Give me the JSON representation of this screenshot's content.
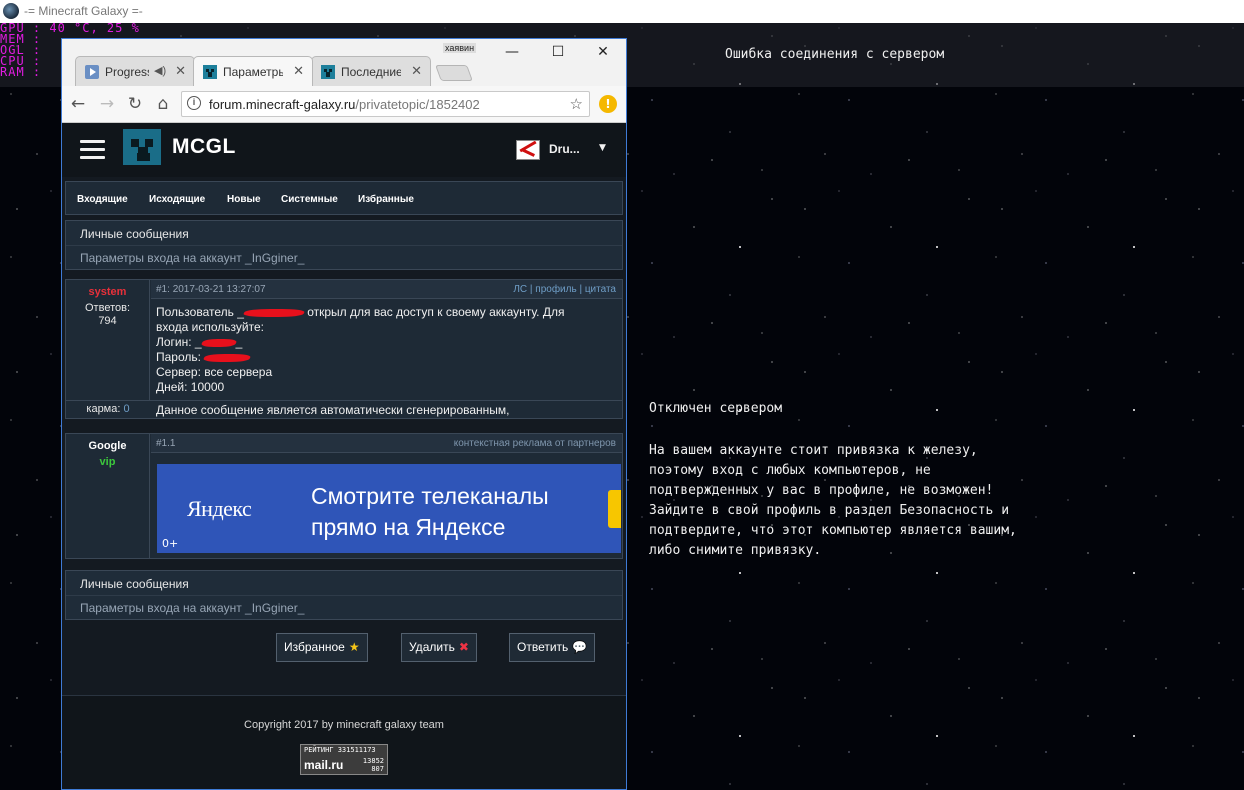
{
  "outer_window": {
    "title": "-= Minecraft Galaxy =-"
  },
  "hud": {
    "rows": [
      "GPU : 40 °C, 25 %",
      "MEM :",
      "OGL :",
      "CPU :",
      "RAM :"
    ]
  },
  "game": {
    "connection_error": "Ошибка соединения с сервером",
    "server_status": "Отключен сервером",
    "server_message": "На вашем аккаунте стоит привязка к железу,\nпоэтому вход с любых компьютеров, не\nподтвержденных у вас в профиле, не возможен!\nЗайдите в свой профиль в раздел Безопасность и\nподтвердите, что этот компьютер является вашим,\nлибо снимите привязку."
  },
  "browser": {
    "window_label": "хаявин",
    "controls": {
      "minimize": "—",
      "maximize": "☐",
      "close": "✕"
    },
    "tabs": [
      {
        "label": "Progress",
        "favicon": "play-icon",
        "audio_icon": "speaker-icon"
      },
      {
        "label": "Параметры",
        "favicon": "creeper-icon"
      },
      {
        "label": "Последние",
        "favicon": "creeper-icon"
      }
    ],
    "tab_close": "✕",
    "address": {
      "host": "forum.minecraft-galaxy.ru",
      "path": "/privatetopic/1852402"
    }
  },
  "site": {
    "logo": "MCGL",
    "user": {
      "name": "Dru...",
      "dropdown_icon": "▼"
    },
    "pm_nav": [
      "Входящие",
      "Исходящие",
      "Новые",
      "Системные",
      "Избранные"
    ],
    "section_title": "Личные сообщения",
    "section_subtitle": "Параметры входа на аккаунт _InGginer_",
    "posts": [
      {
        "author": "system",
        "author_color": "#e8303a",
        "replies_label": "Ответов:",
        "replies": "794",
        "number": "#1:",
        "date": "2017-03-21 13:27:07",
        "links": "ЛС | профиль | цитата",
        "body_line1_a": "Пользователь _",
        "body_line1_b": " открыл для вас доступ к своему аккаунту. Для",
        "body_line2": "входа используйте:",
        "login_label": "Логин: _",
        "login_suffix": "_",
        "password_label": "Пароль: ",
        "server": "Сервер: все сервера",
        "days": "Дней: 10000",
        "karma_label": "карма:",
        "karma": "0",
        "footer_text": "Данное сообщение является автоматически сгенерированным,"
      },
      {
        "author": "Google",
        "author_color": "#ffffff",
        "rank": "vip",
        "rank_color": "#3cc83c",
        "number": "#1.1",
        "links": "контекстная реклама от партнеров"
      }
    ],
    "ad": {
      "brand": "Яндекс",
      "headline_line1": "Смотрите телеканалы",
      "headline_line2": "прямо на Яндексе",
      "age": "0+"
    },
    "buttons": {
      "favorite": "Избранное",
      "favorite_icon": "★",
      "delete": "Удалить",
      "delete_icon": "✖",
      "reply": "Ответить",
      "reply_icon": "💬"
    },
    "footer": {
      "copyright": "Copyright 2017 by minecraft galaxy team",
      "counter_rating": "РЕЙТИНГ 331511173",
      "counter_brand": "mail.ru",
      "counter_num1": "13852",
      "counter_num2": "807"
    }
  }
}
